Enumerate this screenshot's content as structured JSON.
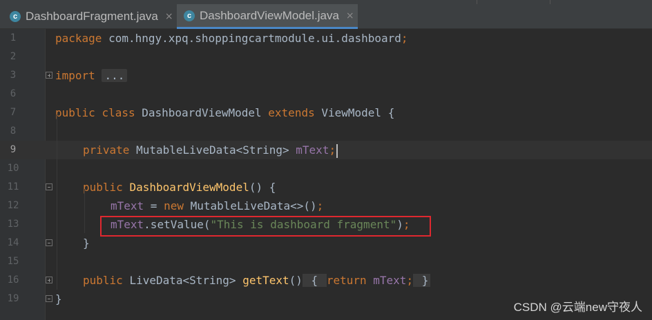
{
  "tabs": [
    {
      "label": "DashboardFragment.java",
      "icon": "class-icon",
      "icon_letter": "c",
      "active": false
    },
    {
      "label": "DashboardViewModel.java",
      "icon": "class-icon",
      "icon_letter": "c",
      "active": true
    }
  ],
  "close_glyph": "×",
  "colors": {
    "background": "#2b2b2b",
    "gutter": "#313335",
    "keyword": "#cc7832",
    "field": "#9876aa",
    "method": "#ffc66d",
    "string": "#6a8759",
    "plain": "#a9b7c6",
    "active_tab_underline": "#4a88c7",
    "highlight_box": "#e0282f"
  },
  "editor": {
    "current_line": 9,
    "lines": [
      {
        "num": "1",
        "tokens": {
          "kw": "package",
          "rest": " com.hngy.xpq.shoppingcartmodule.ui.dashboard",
          "semi": ";"
        }
      },
      {
        "num": "2"
      },
      {
        "num": "3",
        "tokens": {
          "kw": "import",
          "folded": "..."
        }
      },
      {
        "num": "6"
      },
      {
        "num": "7",
        "tokens": {
          "kw1": "public",
          "kw2": "class",
          "name": "DashboardViewModel",
          "kw3": "extends",
          "parent": "ViewModel",
          "brace": "{"
        }
      },
      {
        "num": "8"
      },
      {
        "num": "9",
        "tokens": {
          "kw": "private",
          "type": "MutableLiveData<String>",
          "field": "mText",
          "semi": ";"
        }
      },
      {
        "num": "10"
      },
      {
        "num": "11",
        "tokens": {
          "kw": "public",
          "method": "DashboardViewModel",
          "rest": "() {"
        }
      },
      {
        "num": "12",
        "tokens": {
          "field": "mText",
          "op": " = ",
          "kw": "new",
          "rest": " MutableLiveData<>()",
          "semi": ";"
        }
      },
      {
        "num": "13",
        "tokens": {
          "field": "mText",
          "call": ".setValue(",
          "str": "\"This is dashboard fragment\"",
          "close": ")",
          "semi": ";"
        }
      },
      {
        "num": "14",
        "tokens": {
          "brace": "}"
        }
      },
      {
        "num": "15"
      },
      {
        "num": "16",
        "tokens": {
          "kw": "public",
          "type": "LiveData<String>",
          "method": "getText",
          "paren": "()",
          "lbrace": "{",
          "kw2": "return",
          "field": "mText",
          "semi": ";",
          "rbrace": "}"
        }
      },
      {
        "num": "19",
        "tokens": {
          "brace": "}"
        }
      }
    ]
  },
  "watermark": "CSDN @云端new守夜人"
}
